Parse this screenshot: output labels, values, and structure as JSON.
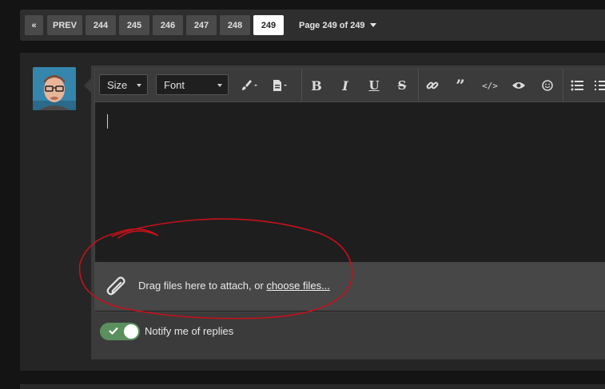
{
  "pagination": {
    "first_label": "«",
    "prev_label": "PREV",
    "pages": [
      "244",
      "245",
      "246",
      "247",
      "248",
      "249"
    ],
    "current_page": "249",
    "page_indicator": "Page 249 of 249"
  },
  "toolbar": {
    "size_label": "Size",
    "font_label": "Font",
    "icons": [
      "paintbrush-icon",
      "paragraph-icon",
      "bold-icon",
      "italic-icon",
      "underline-icon",
      "strikethrough-icon",
      "link-icon",
      "quote-icon",
      "code-icon",
      "preview-icon",
      "smiley-icon",
      "list-icon",
      "ordered-list-icon"
    ]
  },
  "editor": {
    "content": ""
  },
  "attachments": {
    "text": "Drag files here to attach, or ",
    "link_text": "choose files..."
  },
  "notify": {
    "label": "Notify me of replies",
    "enabled": true
  },
  "colors": {
    "annotation": "#c8101a",
    "toggle_on": "#5a8f5e"
  }
}
